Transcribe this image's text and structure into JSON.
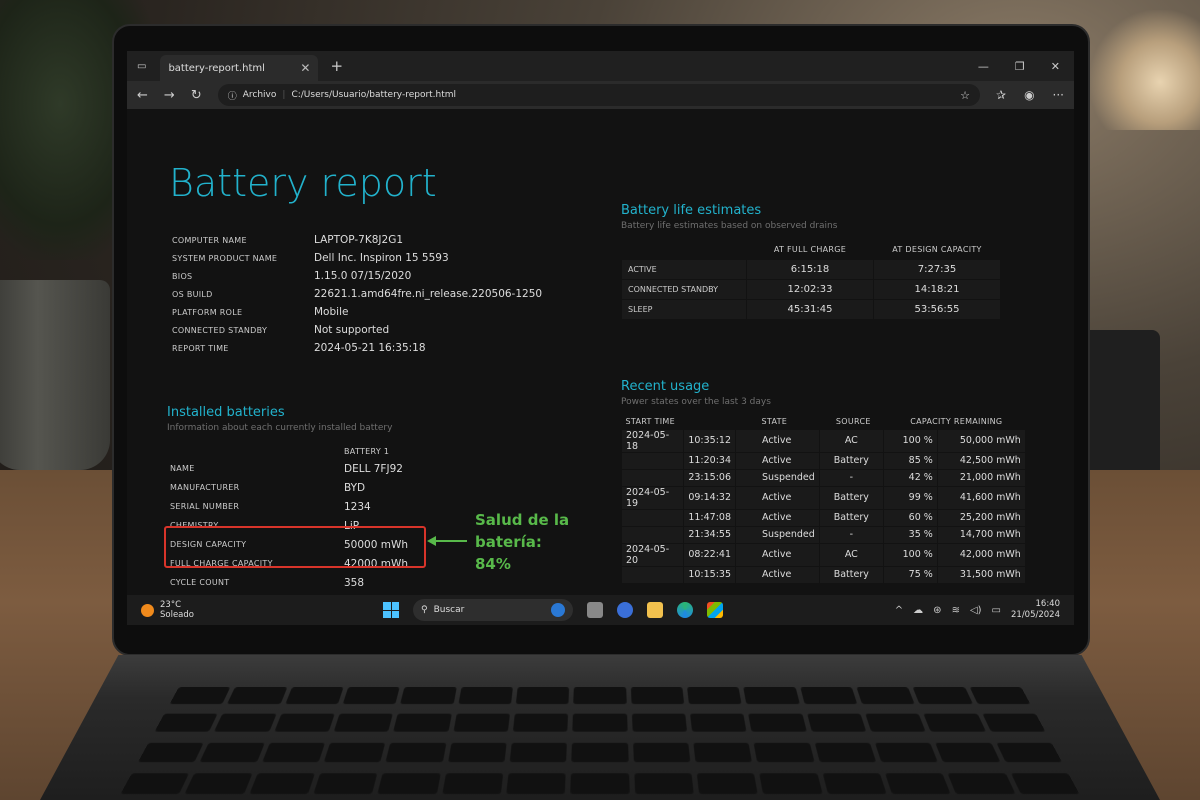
{
  "browser": {
    "tab_title": "battery-report.html",
    "address_label": "Archivo",
    "address_path": "C:/Users/Usuario/battery-report.html"
  },
  "report": {
    "title": "Battery report",
    "system": [
      {
        "key": "COMPUTER NAME",
        "value": "LAPTOP-7K8J2G1"
      },
      {
        "key": "SYSTEM PRODUCT NAME",
        "value": "Dell Inc. Inspiron 15 5593"
      },
      {
        "key": "BIOS",
        "value": "1.15.0 07/15/2020"
      },
      {
        "key": "OS BUILD",
        "value": "22621.1.amd64fre.ni_release.220506-1250"
      },
      {
        "key": "PLATFORM ROLE",
        "value": "Mobile"
      },
      {
        "key": "CONNECTED STANDBY",
        "value": "Not supported"
      },
      {
        "key": "REPORT TIME",
        "value": "2024-05-21   16:35:18"
      }
    ],
    "installed": {
      "heading": "Installed batteries",
      "subheading": "Information about each currently installed battery",
      "column": "BATTERY 1",
      "rows": [
        {
          "key": "NAME",
          "value": "DELL 7FJ92"
        },
        {
          "key": "MANUFACTURER",
          "value": "BYD"
        },
        {
          "key": "SERIAL NUMBER",
          "value": "1234"
        },
        {
          "key": "CHEMISTRY",
          "value": "LiP"
        },
        {
          "key": "DESIGN CAPACITY",
          "value": "50000 mWh"
        },
        {
          "key": "FULL CHARGE CAPACITY",
          "value": "42000 mWh"
        },
        {
          "key": "CYCLE COUNT",
          "value": "358"
        }
      ]
    },
    "annotation": {
      "line1": "Salud de la",
      "line2": "batería:",
      "line3": "84%",
      "color": "#58b94a"
    },
    "estimates": {
      "heading": "Battery life estimates",
      "subheading": "Battery life estimates based on observed drains",
      "col1": "AT FULL CHARGE",
      "col2": "AT DESIGN CAPACITY",
      "rows": [
        {
          "key": "ACTIVE",
          "full": "6:15:18",
          "design": "7:27:35"
        },
        {
          "key": "CONNECTED STANDBY",
          "full": "12:02:33",
          "design": "14:18:21"
        },
        {
          "key": "SLEEP",
          "full": "45:31:45",
          "design": "53:56:55"
        }
      ]
    },
    "usage": {
      "heading": "Recent usage",
      "subheading": "Power states over the last 3 days",
      "headers": [
        "START TIME",
        "STATE",
        "SOURCE",
        "CAPACITY REMAINING"
      ],
      "rows": [
        {
          "date": "2024-05-18",
          "time": "10:35:12",
          "state": "Active",
          "source": "AC",
          "pct": "100 %",
          "mwh": "50,000 mWh"
        },
        {
          "date": "",
          "time": "11:20:34",
          "state": "Active",
          "source": "Battery",
          "pct": "85 %",
          "mwh": "42,500 mWh"
        },
        {
          "date": "",
          "time": "23:15:06",
          "state": "Suspended",
          "source": "-",
          "pct": "42 %",
          "mwh": "21,000 mWh"
        },
        {
          "date": "2024-05-19",
          "time": "09:14:32",
          "state": "Active",
          "source": "Battery",
          "pct": "99 %",
          "mwh": "41,600 mWh"
        },
        {
          "date": "",
          "time": "11:47:08",
          "state": "Active",
          "source": "Battery",
          "pct": "60 %",
          "mwh": "25,200 mWh"
        },
        {
          "date": "",
          "time": "21:34:55",
          "state": "Suspended",
          "source": "-",
          "pct": "35 %",
          "mwh": "14,700 mWh"
        },
        {
          "date": "2024-05-20",
          "time": "08:22:41",
          "state": "Active",
          "source": "AC",
          "pct": "100 %",
          "mwh": "42,000 mWh"
        },
        {
          "date": "",
          "time": "10:15:35",
          "state": "Active",
          "source": "Battery",
          "pct": "75 %",
          "mwh": "31,500 mWh"
        }
      ]
    }
  },
  "taskbar": {
    "temp": "23°C",
    "weather": "Soleado",
    "search_placeholder": "Buscar",
    "time": "16:40",
    "date": "21/05/2024"
  },
  "colors": {
    "accent": "#22b2cc",
    "highlight": "#d8342a"
  }
}
